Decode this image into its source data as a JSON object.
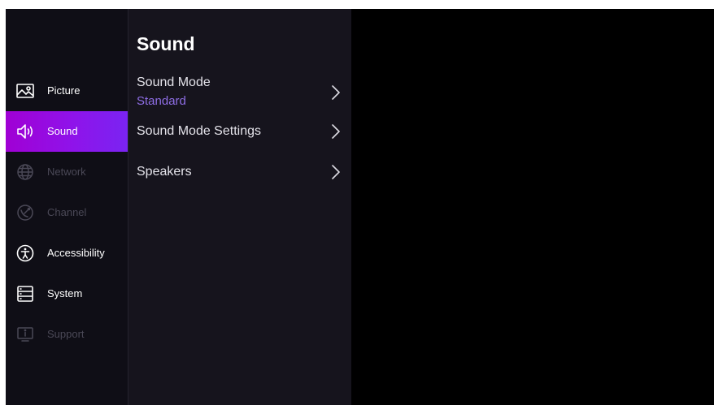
{
  "sidebar": {
    "items": [
      {
        "label": "Picture",
        "icon": "picture-icon",
        "state": "normal"
      },
      {
        "label": "Sound",
        "icon": "speaker-icon",
        "state": "active"
      },
      {
        "label": "Network",
        "icon": "globe-icon",
        "state": "disabled"
      },
      {
        "label": "Channel",
        "icon": "satellite-dish-icon",
        "state": "disabled"
      },
      {
        "label": "Accessibility",
        "icon": "accessibility-icon",
        "state": "normal"
      },
      {
        "label": "System",
        "icon": "server-icon",
        "state": "normal"
      },
      {
        "label": "Support",
        "icon": "info-screen-icon",
        "state": "disabled"
      }
    ]
  },
  "submenu": {
    "title": "Sound",
    "items": [
      {
        "title": "Sound Mode",
        "value": "Standard"
      },
      {
        "title": "Sound Mode Settings"
      },
      {
        "title": "Speakers"
      }
    ]
  },
  "colors": {
    "accent_gradient_start": "#a000d4",
    "accent_gradient_end": "#7a24f2",
    "value_text": "#8f6ee6",
    "disabled_text": "#4a4856"
  }
}
